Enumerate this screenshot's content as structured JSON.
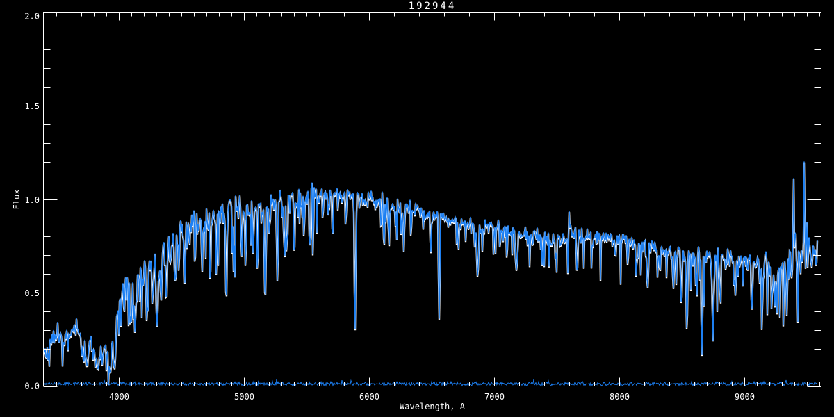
{
  "window": {
    "background": "#000000"
  },
  "chart_data": {
    "type": "line",
    "title": "192944",
    "xlabel": "Wavelength, A",
    "ylabel": "Flux",
    "xlim": [
      3400,
      9615
    ],
    "ylim": [
      0.0,
      2.0
    ],
    "grid": false,
    "legend": null,
    "axes_style": "boxed-inward-ticks",
    "xticks": {
      "major": [
        4000,
        5000,
        6000,
        7000,
        8000,
        9000
      ],
      "labels": [
        "4000",
        "5000",
        "6000",
        "7000",
        "8000",
        "9000"
      ],
      "minor_step": 100
    },
    "yticks": {
      "major": [
        0.0,
        0.5,
        1.0,
        1.5,
        2.0
      ],
      "labels": [
        "0.0",
        "0.5",
        "1.0",
        "1.5",
        "2.0"
      ],
      "minor_step": 0.1
    },
    "colors": {
      "background": "#000000",
      "axis": "#ffffff",
      "spectrum": "#1c7ff2",
      "spectrum_underlay": "#ffffff"
    },
    "main_series": {
      "name": "spectrum",
      "description": "noisy stellar spectrum, flux-normalized",
      "continuum": [
        [
          3402,
          0.19
        ],
        [
          3450,
          0.22
        ],
        [
          3500,
          0.26
        ],
        [
          3530,
          0.3
        ],
        [
          3560,
          0.2
        ],
        [
          3600,
          0.27
        ],
        [
          3640,
          0.31
        ],
        [
          3680,
          0.28
        ],
        [
          3710,
          0.19
        ],
        [
          3745,
          0.18
        ],
        [
          3780,
          0.26
        ],
        [
          3810,
          0.22
        ],
        [
          3840,
          0.15
        ],
        [
          3870,
          0.23
        ],
        [
          3900,
          0.18
        ],
        [
          3940,
          0.14
        ],
        [
          3970,
          0.22
        ],
        [
          4000,
          0.45
        ],
        [
          4040,
          0.54
        ],
        [
          4080,
          0.55
        ],
        [
          4120,
          0.56
        ],
        [
          4160,
          0.6
        ],
        [
          4200,
          0.61
        ],
        [
          4260,
          0.63
        ],
        [
          4320,
          0.66
        ],
        [
          4380,
          0.72
        ],
        [
          4440,
          0.77
        ],
        [
          4500,
          0.82
        ],
        [
          4560,
          0.86
        ],
        [
          4620,
          0.88
        ],
        [
          4700,
          0.89
        ],
        [
          4800,
          0.92
        ],
        [
          4900,
          0.95
        ],
        [
          5000,
          0.94
        ],
        [
          5100,
          0.96
        ],
        [
          5200,
          0.96
        ],
        [
          5300,
          0.99
        ],
        [
          5400,
          1.0
        ],
        [
          5500,
          1.02
        ],
        [
          5600,
          1.03
        ],
        [
          5700,
          1.03
        ],
        [
          5800,
          1.02
        ],
        [
          5900,
          1.01
        ],
        [
          6000,
          1.0
        ],
        [
          6100,
          0.99
        ],
        [
          6200,
          0.97
        ],
        [
          6300,
          0.95
        ],
        [
          6400,
          0.93
        ],
        [
          6500,
          0.91
        ],
        [
          6600,
          0.9
        ],
        [
          6700,
          0.88
        ],
        [
          6800,
          0.87
        ],
        [
          6900,
          0.86
        ],
        [
          7000,
          0.85
        ],
        [
          7100,
          0.84
        ],
        [
          7200,
          0.82
        ],
        [
          7300,
          0.81
        ],
        [
          7400,
          0.8
        ],
        [
          7500,
          0.79
        ],
        [
          7600,
          0.8
        ],
        [
          7700,
          0.8
        ],
        [
          7800,
          0.8
        ],
        [
          7900,
          0.79
        ],
        [
          8000,
          0.78
        ],
        [
          8100,
          0.76
        ],
        [
          8200,
          0.75
        ],
        [
          8300,
          0.74
        ],
        [
          8400,
          0.73
        ],
        [
          8500,
          0.71
        ],
        [
          8600,
          0.7
        ],
        [
          8700,
          0.7
        ],
        [
          8800,
          0.69
        ],
        [
          8900,
          0.68
        ],
        [
          9000,
          0.68
        ],
        [
          9100,
          0.64
        ],
        [
          9200,
          0.63
        ],
        [
          9300,
          0.63
        ],
        [
          9400,
          0.65
        ],
        [
          9500,
          0.68
        ],
        [
          9587,
          0.7
        ]
      ],
      "noise_regions": [
        [
          3400,
          4000,
          0.04
        ],
        [
          4000,
          4500,
          0.05
        ],
        [
          4500,
          5000,
          0.045
        ],
        [
          5000,
          5600,
          0.04
        ],
        [
          5600,
          6400,
          0.03
        ],
        [
          6400,
          7500,
          0.025
        ],
        [
          7500,
          8400,
          0.028
        ],
        [
          8400,
          9050,
          0.032
        ],
        [
          9050,
          9300,
          0.05
        ],
        [
          9300,
          9615,
          0.065
        ]
      ],
      "dip_forest": [
        [
          3400,
          4000,
          0.1,
          0.1
        ],
        [
          4000,
          4700,
          0.18,
          0.28
        ],
        [
          4700,
          5600,
          0.14,
          0.3
        ],
        [
          5600,
          6500,
          0.1,
          0.16
        ],
        [
          6500,
          7600,
          0.1,
          0.15
        ],
        [
          7600,
          8500,
          0.12,
          0.2
        ],
        [
          8500,
          9100,
          0.12,
          0.25
        ],
        [
          9100,
          9615,
          0.12,
          0.28
        ]
      ],
      "absorption_lines": [
        [
          3750,
          0.1,
          12
        ],
        [
          3797,
          0.14,
          8
        ],
        [
          3835,
          0.09,
          10
        ],
        [
          3870,
          0.11,
          8
        ],
        [
          3933,
          0.07,
          14
        ],
        [
          3968,
          0.09,
          14
        ],
        [
          4045,
          0.38,
          8
        ],
        [
          4101,
          0.33,
          12
        ],
        [
          4144,
          0.42,
          8
        ],
        [
          4226,
          0.34,
          10
        ],
        [
          4271,
          0.42,
          8
        ],
        [
          4308,
          0.32,
          14
        ],
        [
          4340,
          0.45,
          10
        ],
        [
          4383,
          0.44,
          10
        ],
        [
          4455,
          0.52,
          8
        ],
        [
          4530,
          0.55,
          8
        ],
        [
          4668,
          0.6,
          8
        ],
        [
          4861,
          0.42,
          10
        ],
        [
          4920,
          0.6,
          8
        ],
        [
          5015,
          0.62,
          8
        ],
        [
          5110,
          0.58,
          8
        ],
        [
          5172,
          0.44,
          12
        ],
        [
          5270,
          0.55,
          10
        ],
        [
          5328,
          0.65,
          8
        ],
        [
          5405,
          0.68,
          8
        ],
        [
          5528,
          0.72,
          8
        ],
        [
          5711,
          0.78,
          8
        ],
        [
          5890,
          0.28,
          10
        ],
        [
          6122,
          0.72,
          8
        ],
        [
          6162,
          0.74,
          8
        ],
        [
          6280,
          0.72,
          8
        ],
        [
          6495,
          0.7,
          8
        ],
        [
          6563,
          0.36,
          10
        ],
        [
          6717,
          0.72,
          8
        ],
        [
          6870,
          0.58,
          14
        ],
        [
          7180,
          0.62,
          16
        ],
        [
          7593,
          0.55,
          8
        ],
        [
          7665,
          0.6,
          10
        ],
        [
          8228,
          0.52,
          12
        ],
        [
          8327,
          0.6,
          8
        ],
        [
          8434,
          0.52,
          10
        ],
        [
          8498,
          0.42,
          10
        ],
        [
          8542,
          0.28,
          10
        ],
        [
          8662,
          0.16,
          10
        ],
        [
          8750,
          0.21,
          8
        ],
        [
          8806,
          0.5,
          8
        ],
        [
          8920,
          0.52,
          8
        ],
        [
          9061,
          0.4,
          10
        ],
        [
          9145,
          0.45,
          8
        ],
        [
          9245,
          0.42,
          8
        ],
        [
          9340,
          0.38,
          8
        ]
      ],
      "emission_spikes": [
        [
          7600,
          0.97,
          10
        ],
        [
          7615,
          0.92,
          6
        ],
        [
          9365,
          0.9,
          6
        ],
        [
          9395,
          1.16,
          8
        ],
        [
          9410,
          0.95,
          6
        ],
        [
          9480,
          1.31,
          8
        ],
        [
          9500,
          0.95,
          6
        ],
        [
          9520,
          0.9,
          6
        ]
      ]
    },
    "error_series": {
      "name": "error-spectrum",
      "level": 0.012,
      "noise_amp": 0.012
    }
  }
}
